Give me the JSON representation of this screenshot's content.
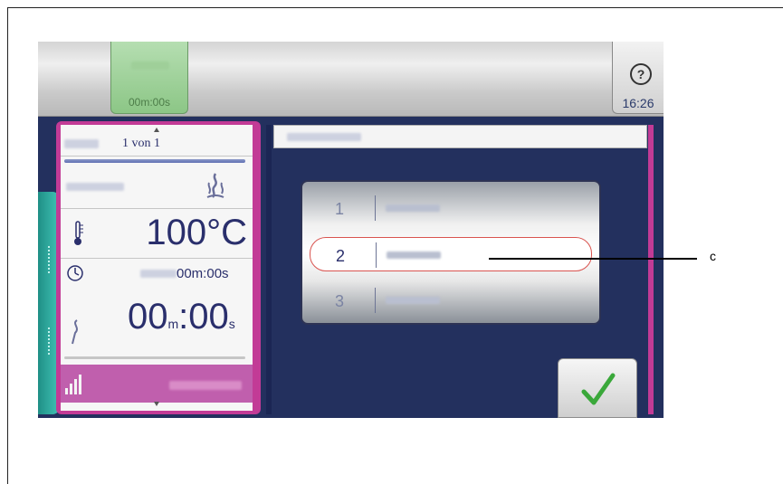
{
  "topbar": {
    "timer_value": "00m:00s",
    "help_symbol": "?",
    "clock": "16:26"
  },
  "panel": {
    "counter": "1 von 1",
    "temperature": "100°C",
    "time_small": "00m:00s",
    "time_large_minutes": "00",
    "time_large_m": "m",
    "time_large_colon": ":",
    "time_large_seconds": "00",
    "time_large_s": "s"
  },
  "list": {
    "items": [
      {
        "number": "1"
      },
      {
        "number": "2"
      },
      {
        "number": "3"
      }
    ],
    "selected_index": 1
  },
  "callout": {
    "label": "c"
  },
  "colors": {
    "accent_magenta": "#c23b96",
    "screen_blue": "#23305e",
    "timer_green": "#8cc686",
    "teal": "#2fb3a6",
    "checkmark": "#3aa83a"
  },
  "icons": [
    "help-icon",
    "steam-flame-icon",
    "thermometer-icon",
    "clock-icon",
    "probe-icon",
    "steam-level-icon",
    "checkmark-icon"
  ]
}
